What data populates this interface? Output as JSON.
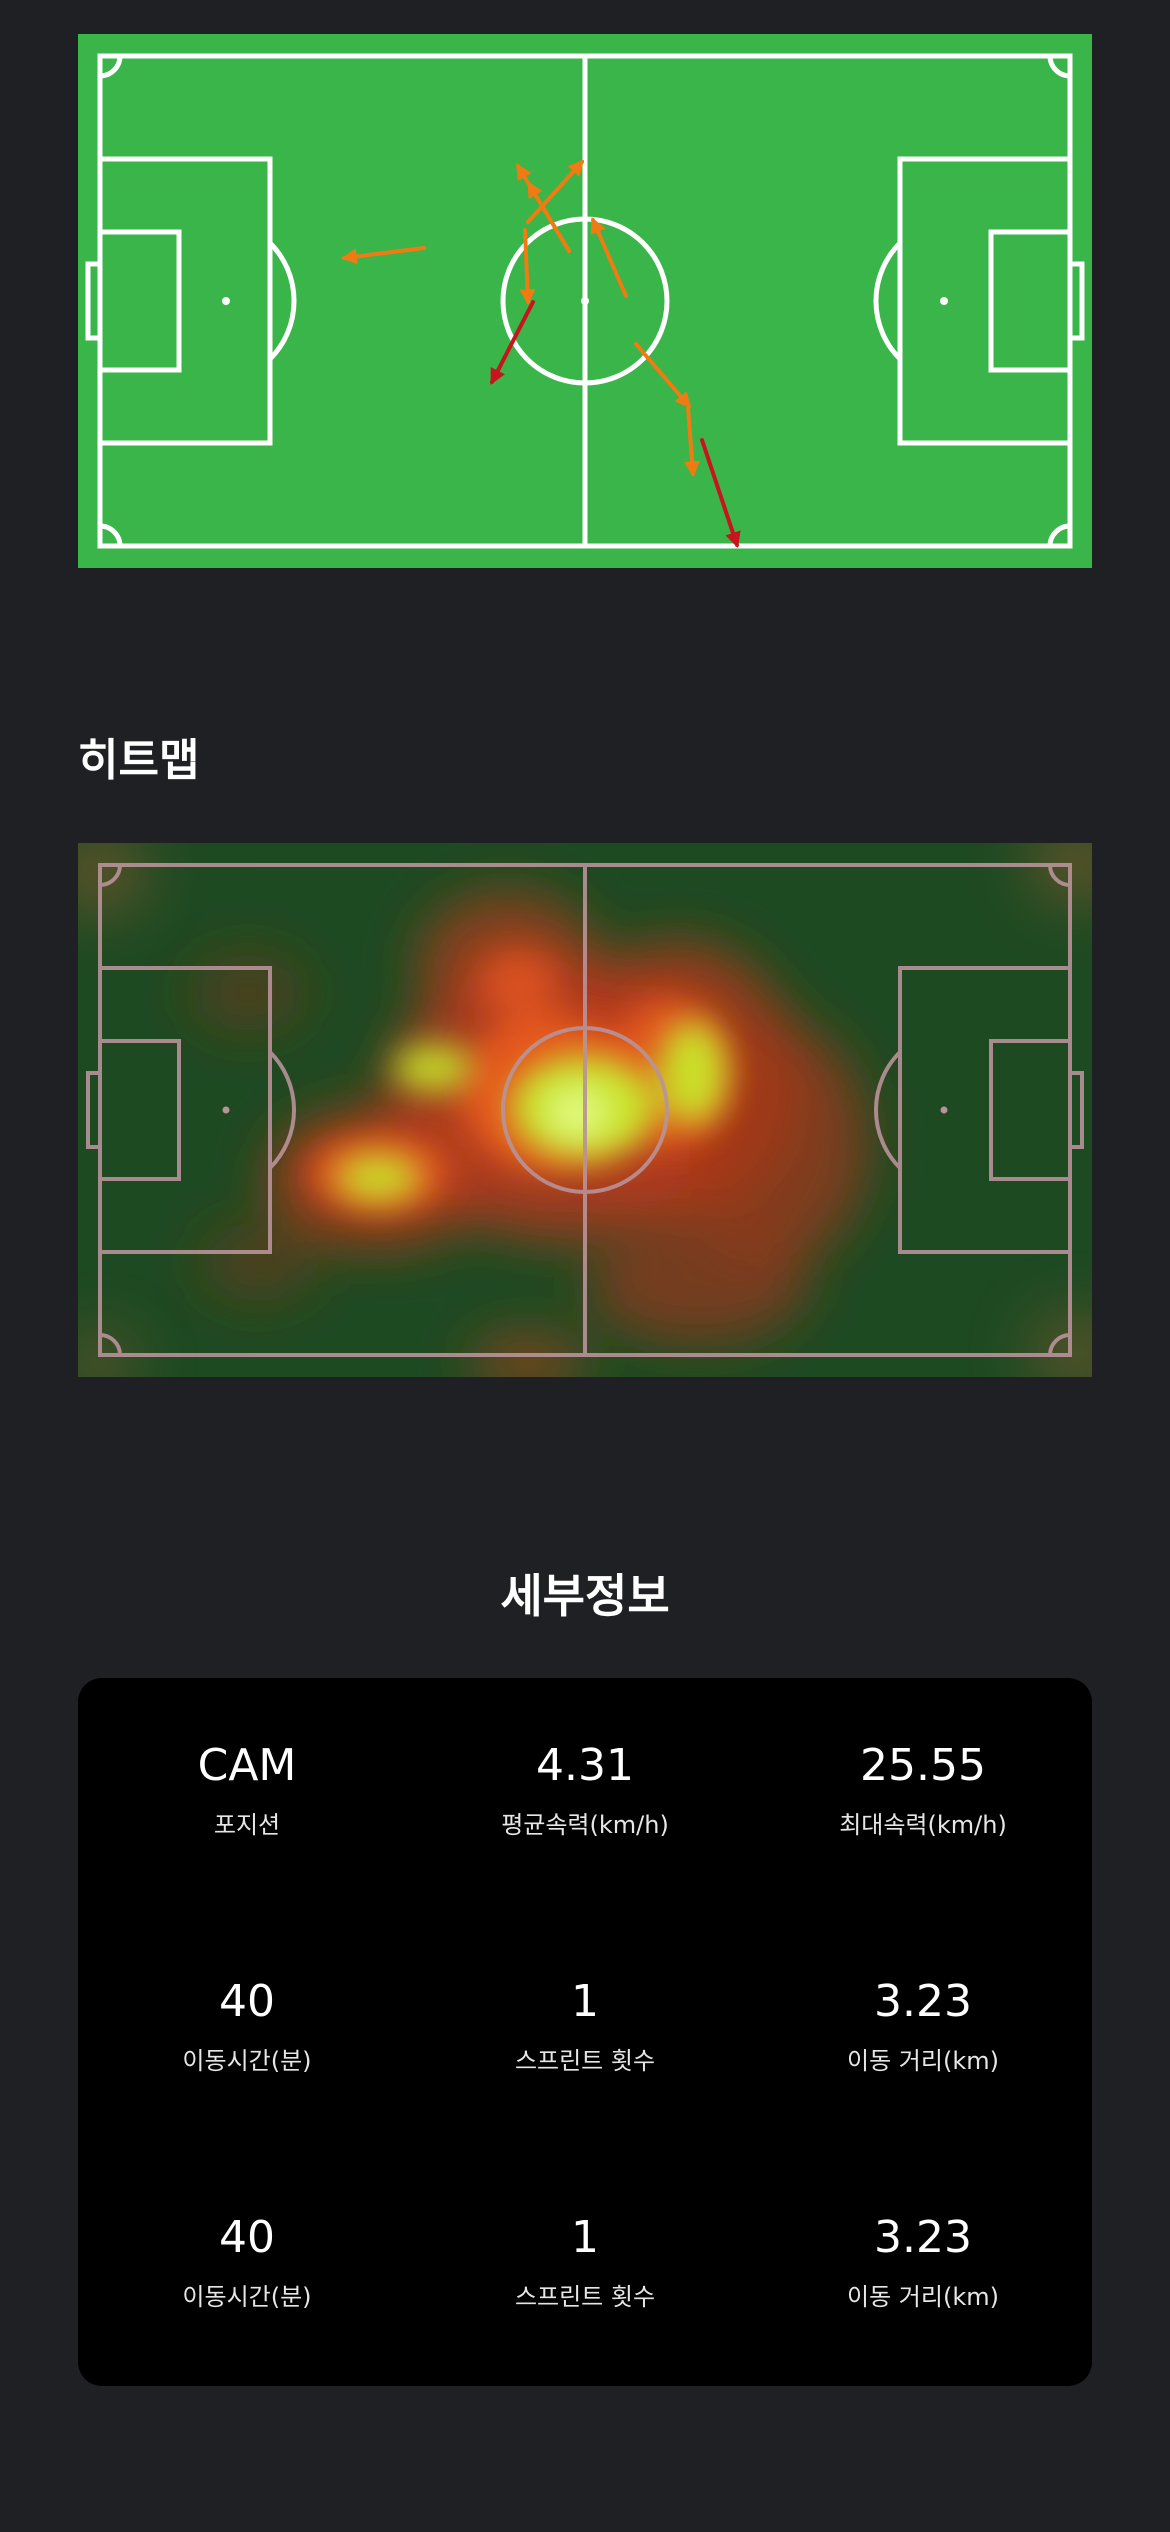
{
  "pass_map": {
    "colors": {
      "grass": "#3ab54a",
      "pass_completed": "#f07b12",
      "pass_failed": "#c8141c",
      "lines": "#ffffff"
    }
  },
  "heatmap": {
    "title": "히트맵",
    "colors": {
      "pitch": "#1e4a22",
      "lines": "#b8939a",
      "hot_low": "#d8401c",
      "hot_high": "#c8ee2a"
    }
  },
  "details": {
    "title": "세부정보",
    "stats": [
      {
        "value": "CAM",
        "label": "포지션"
      },
      {
        "value": "4.31",
        "label": "평균속력(km/h)"
      },
      {
        "value": "25.55",
        "label": "최대속력(km/h)"
      },
      {
        "value": "40",
        "label": "이동시간(분)"
      },
      {
        "value": "1",
        "label": "스프린트 횟수"
      },
      {
        "value": "3.23",
        "label": "이동 거리(km)"
      },
      {
        "value": "40",
        "label": "이동시간(분)"
      },
      {
        "value": "1",
        "label": "스프린트 횟수"
      },
      {
        "value": "3.23",
        "label": "이동 거리(km)"
      }
    ]
  }
}
